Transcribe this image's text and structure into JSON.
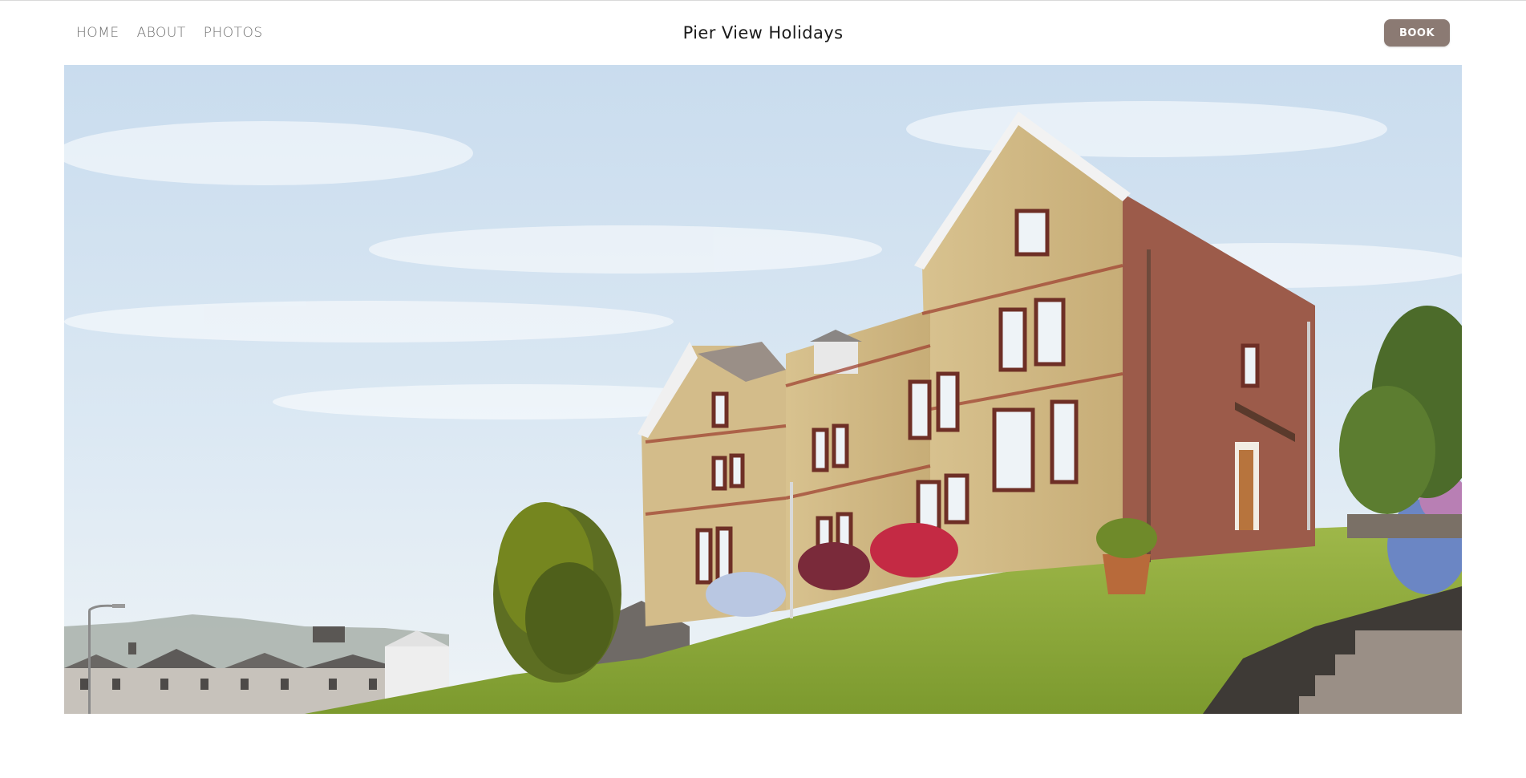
{
  "nav": {
    "items": [
      {
        "label": "HOME"
      },
      {
        "label": "ABOUT"
      },
      {
        "label": "PHOTOS"
      }
    ]
  },
  "brand": {
    "title": "Pier View Holidays"
  },
  "actions": {
    "book_label": "BOOK"
  },
  "colors": {
    "book_button": "#8b7a73",
    "nav_text": "#6f6f6f",
    "title_text": "#1b1b1b"
  },
  "hero": {
    "icon": "house-photo"
  }
}
